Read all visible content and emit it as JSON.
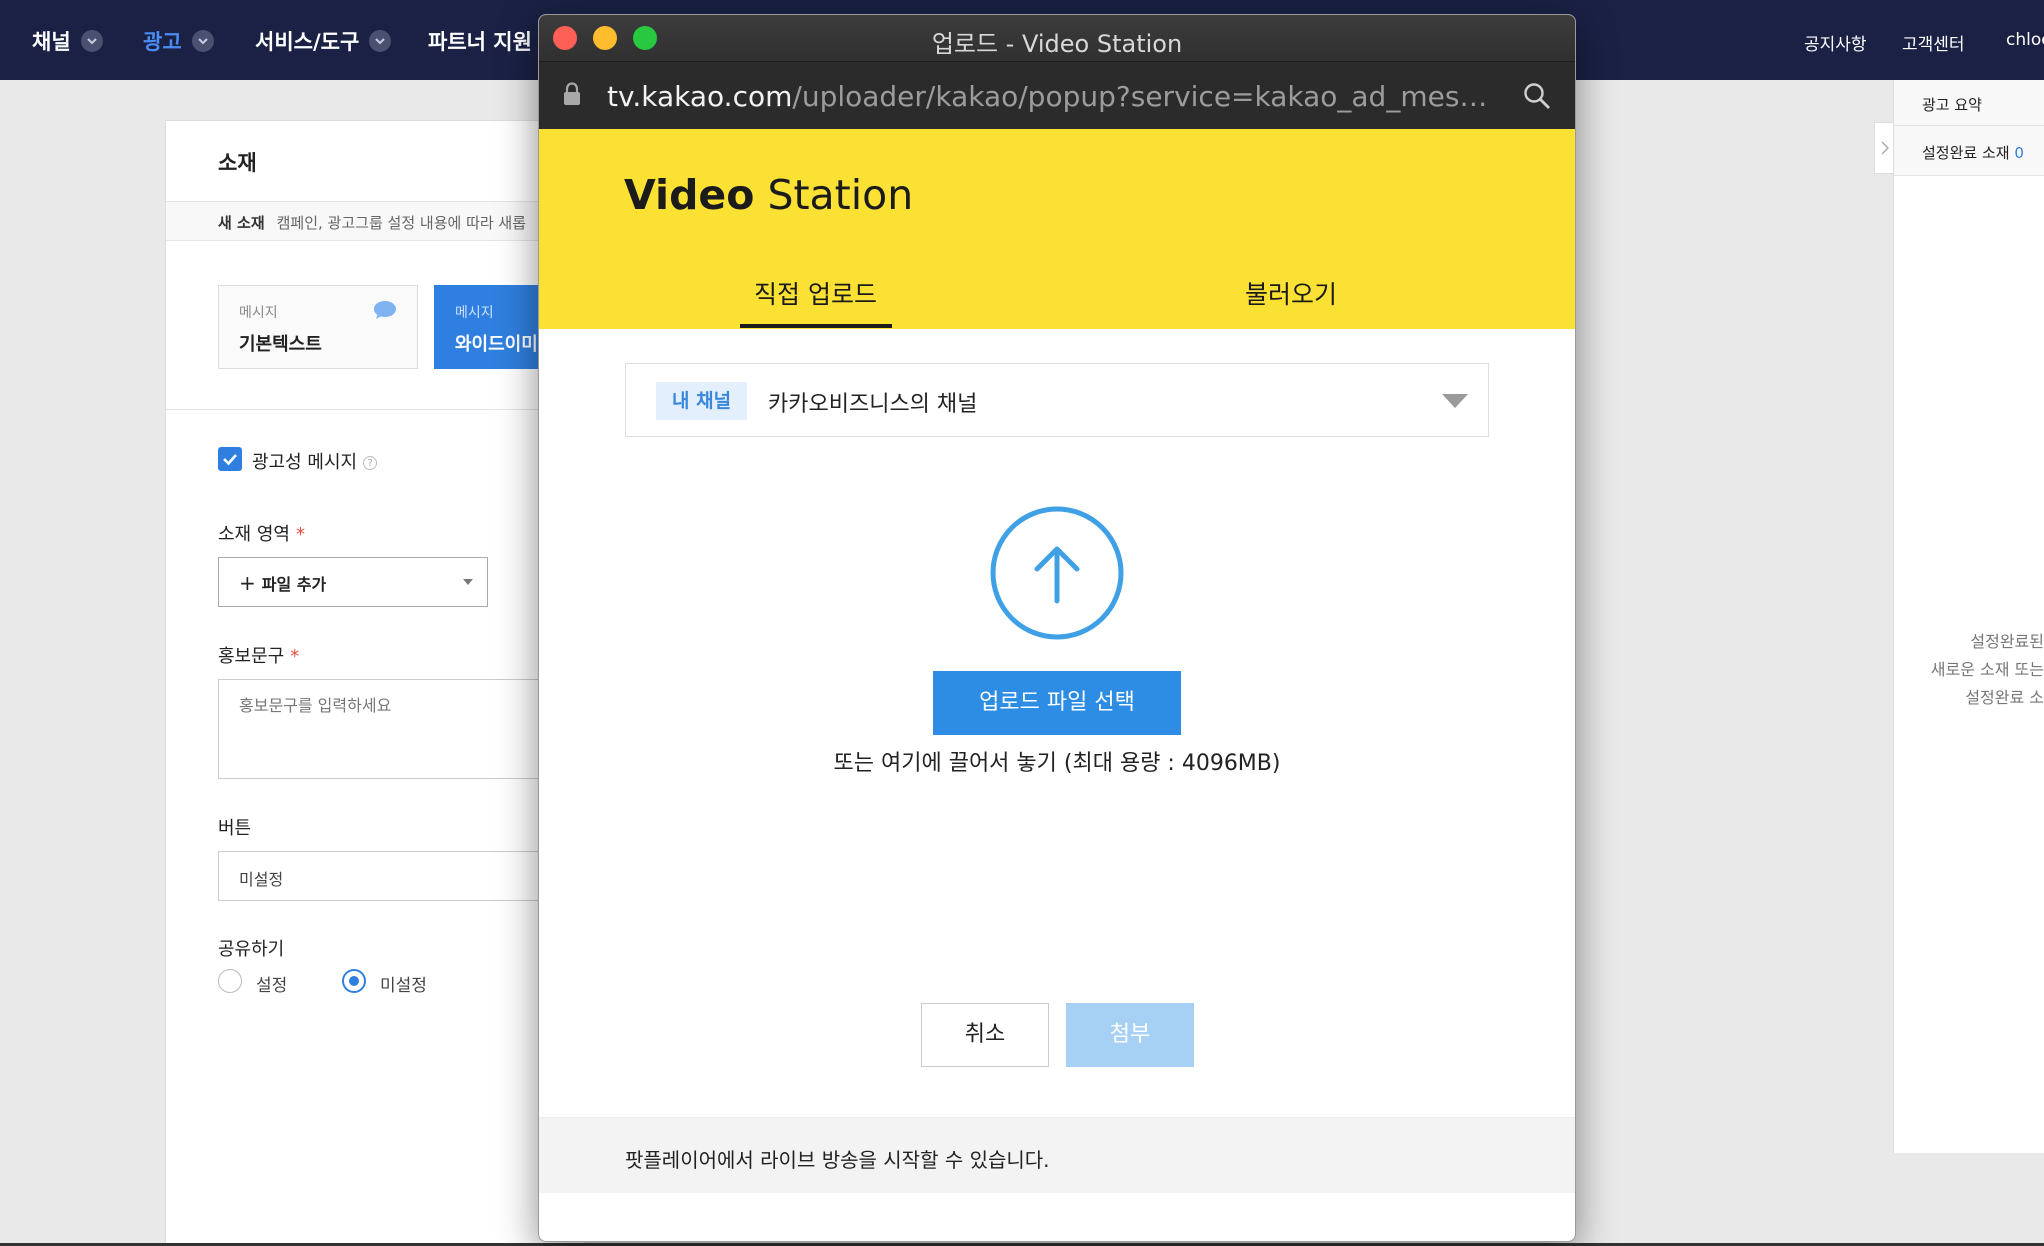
{
  "nav": {
    "items": [
      {
        "label": "채널",
        "active": false
      },
      {
        "label": "광고",
        "active": true
      },
      {
        "label": "서비스/도구",
        "active": false
      },
      {
        "label": "파트너 지원",
        "active": false
      }
    ],
    "right": {
      "notice": "공지사항",
      "support": "고객센터",
      "user": "chloe"
    }
  },
  "panel": {
    "title": "소재",
    "sub_label": "새 소재",
    "sub_text": "캠페인, 광고그룹 설정 내용에 따라 새롭",
    "types": [
      {
        "small": "메시지",
        "big": "기본텍스트",
        "selected": false
      },
      {
        "small": "메시지",
        "big": "와이드이미",
        "selected": true
      }
    ],
    "ad_message_label": "광고성 메시지",
    "ad_message_checked": true,
    "area_label": "소재 영역",
    "area_add": "파일 추가",
    "promo_label": "홍보문구",
    "promo_placeholder": "홍보문구를 입력하세요",
    "button_label": "버튼",
    "button_value": "미설정",
    "share_label": "공유하기",
    "share_options": [
      {
        "label": "설정",
        "selected": false
      },
      {
        "label": "미설정",
        "selected": true
      }
    ],
    "required_mark": "*",
    "help_mark": "?"
  },
  "sidebar": {
    "summary": "광고 요약",
    "done_label": "설정완료 소재",
    "done_count": "0",
    "empty_lines": [
      "설정완료된",
      "새로운 소재 또는",
      "설정완료 소"
    ]
  },
  "popup": {
    "window_title": "업로드 - Video Station",
    "url_host": "tv.kakao.com",
    "url_path": "/uploader/kakao/popup?service=kakao_ad_message...",
    "logo_bold": "Video",
    "logo_light": "Station",
    "tabs": [
      {
        "label": "직접 업로드",
        "active": true
      },
      {
        "label": "불러오기",
        "active": false
      }
    ],
    "channel_badge": "내 채널",
    "channel_name": "카카오비즈니스의 채널",
    "upload_button": "업로드 파일 선택",
    "upload_hint": "또는 여기에 끌어서 놓기 (최대 용량 : 4096MB)",
    "cancel_button": "취소",
    "attach_button": "첨부",
    "footer_text": "팟플레이어에서 라이브 방송을 시작할 수 있습니다."
  },
  "colors": {
    "nav_bg": "#1a2145",
    "accent_blue": "#2d8ce3",
    "video_station_yellow": "#fae134",
    "attach_disabled": "#a6d1f5",
    "traffic_close": "#fe5f57",
    "traffic_min": "#febc2e",
    "traffic_max": "#28c840"
  }
}
